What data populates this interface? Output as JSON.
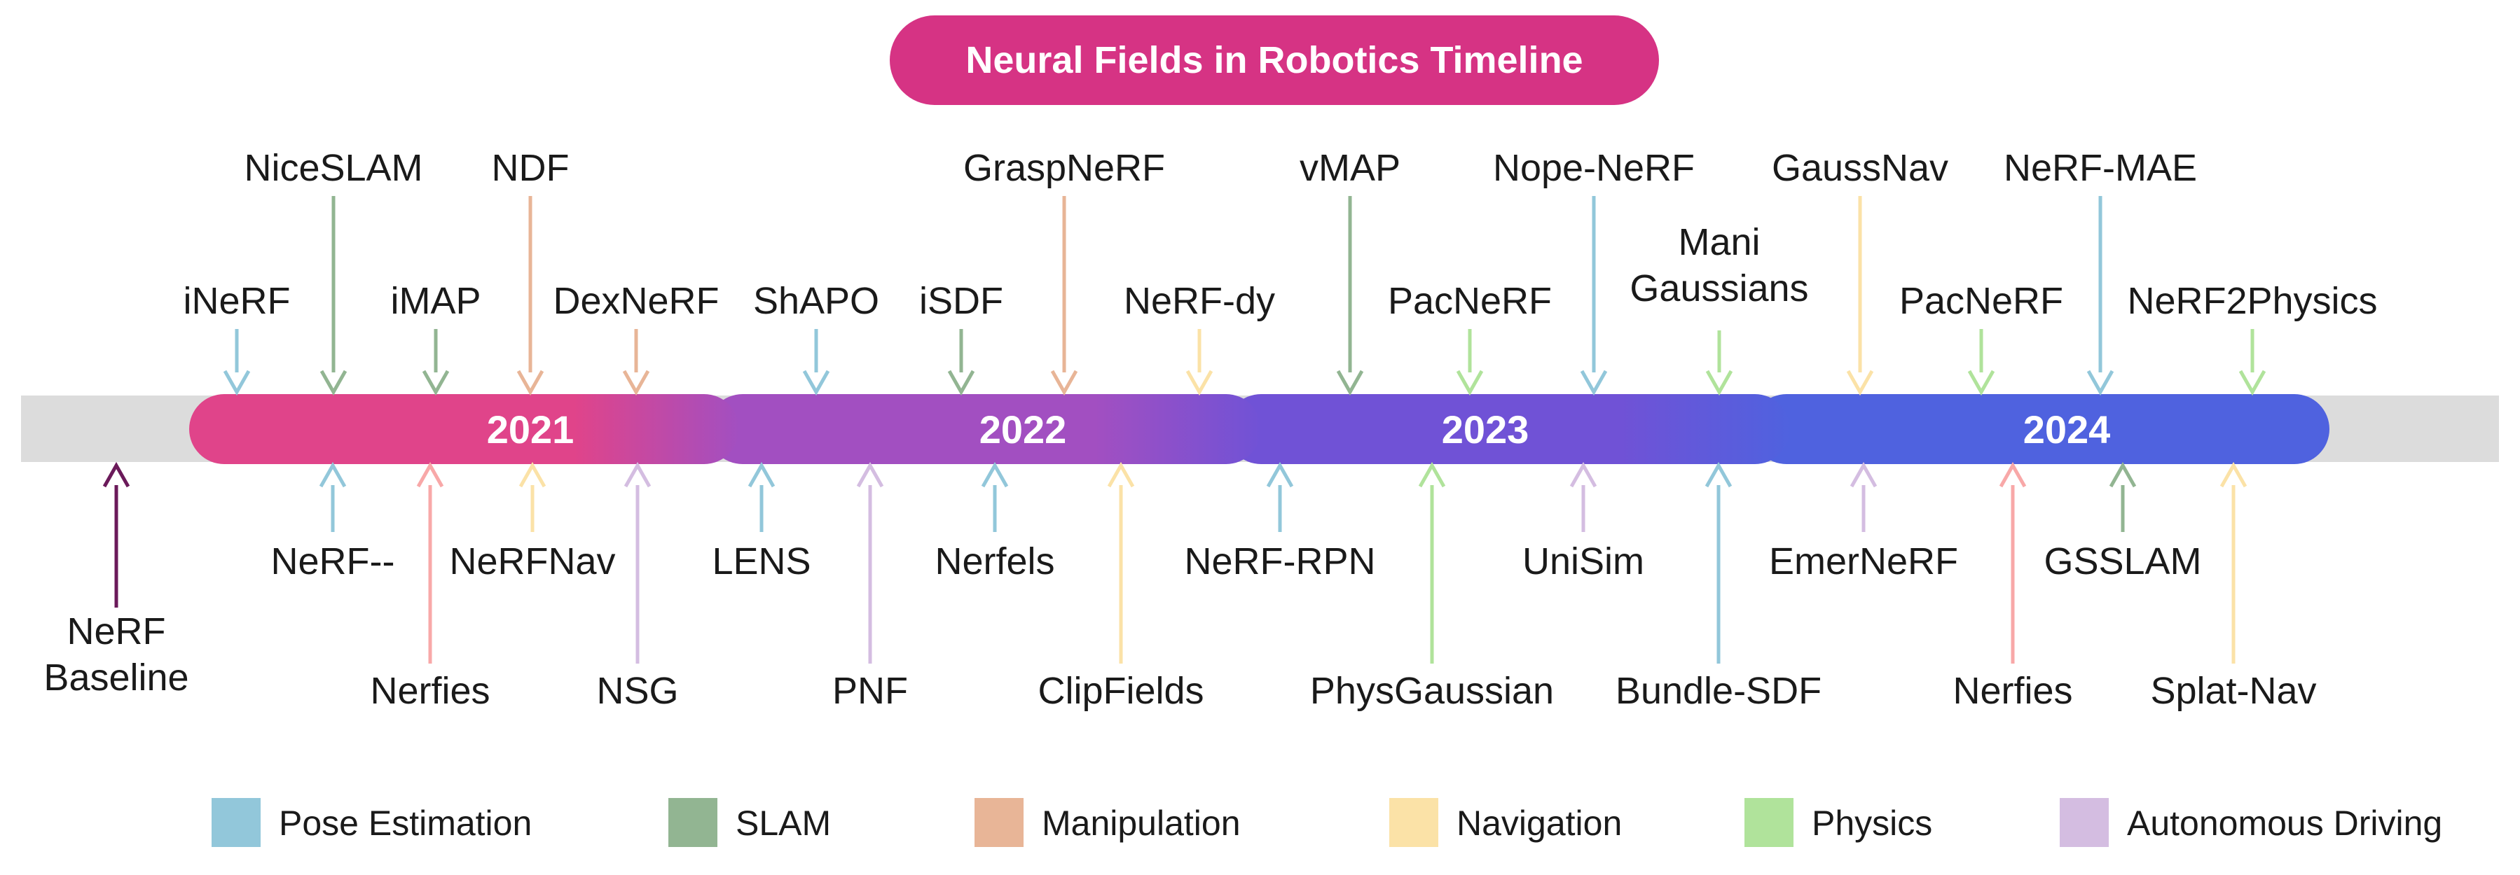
{
  "title": "Neural Fields in Robotics Timeline",
  "colors": {
    "title_bg": "#d63384",
    "track": "#dcdcdc",
    "years": [
      "#e0448a",
      "#a24fc1",
      "#7052d6",
      "#4f62df"
    ],
    "Pose Estimation": "#92c7da",
    "SLAM": "#92b592",
    "Manipulation": "#e8b597",
    "Navigation": "#fbe2a7",
    "Physics": "#b0e39b",
    "Autonomous Driving": "#d4bde1",
    "Pink": "#f8a8a8",
    "Baseline": "#6b1a5a"
  },
  "years": [
    "2021",
    "2022",
    "2023",
    "2024"
  ],
  "top": [
    {
      "label": "iNeRF",
      "cat": "Pose Estimation",
      "row": 0
    },
    {
      "label": "NiceSLAM",
      "cat": "SLAM",
      "row": 2
    },
    {
      "label": "iMAP",
      "cat": "SLAM",
      "row": 0
    },
    {
      "label": "NDF",
      "cat": "Manipulation",
      "row": 2
    },
    {
      "label": "DexNeRF",
      "cat": "Manipulation",
      "row": 0
    },
    {
      "label": "ShAPO",
      "cat": "Pose Estimation",
      "row": 0
    },
    {
      "label": "iSDF",
      "cat": "SLAM",
      "row": 0
    },
    {
      "label": "GraspNeRF",
      "cat": "Manipulation",
      "row": 2
    },
    {
      "label": "NeRF-dy",
      "cat": "Navigation",
      "row": 0
    },
    {
      "label": "vMAP",
      "cat": "SLAM",
      "row": 2
    },
    {
      "label": "PacNeRF",
      "cat": "Physics",
      "row": 0
    },
    {
      "label": "Nope-NeRF",
      "cat": "Pose Estimation",
      "row": 2
    },
    {
      "label": "Mani\nGaussians",
      "cat": "Physics",
      "row": 1
    },
    {
      "label": "GaussNav",
      "cat": "Navigation",
      "row": 2
    },
    {
      "label": "PacNeRF",
      "cat": "Physics",
      "row": 0
    },
    {
      "label": "NeRF-MAE",
      "cat": "Pose Estimation",
      "row": 2
    },
    {
      "label": "NeRF2Physics",
      "cat": "Physics",
      "row": 0
    }
  ],
  "bottom": [
    {
      "label": "NeRF\nBaseline",
      "cat": "Baseline",
      "row": 2
    },
    {
      "label": "NeRF--",
      "cat": "Pose Estimation",
      "row": 0
    },
    {
      "label": "Nerfies",
      "cat": "Pink",
      "row": 1
    },
    {
      "label": "NeRFNav",
      "cat": "Navigation",
      "row": 0
    },
    {
      "label": "NSG",
      "cat": "Autonomous Driving",
      "row": 1
    },
    {
      "label": "LENS",
      "cat": "Pose Estimation",
      "row": 0
    },
    {
      "label": "PNF",
      "cat": "Autonomous Driving",
      "row": 1
    },
    {
      "label": "Nerfels",
      "cat": "Pose Estimation",
      "row": 0
    },
    {
      "label": "ClipFields",
      "cat": "Navigation",
      "row": 1
    },
    {
      "label": "NeRF-RPN",
      "cat": "Pose Estimation",
      "row": 0
    },
    {
      "label": "PhysGaussian",
      "cat": "Physics",
      "row": 1
    },
    {
      "label": "UniSim",
      "cat": "Autonomous Driving",
      "row": 0
    },
    {
      "label": "Bundle-SDF",
      "cat": "Pose Estimation",
      "row": 1
    },
    {
      "label": "EmerNeRF",
      "cat": "Autonomous Driving",
      "row": 0
    },
    {
      "label": "Nerfies",
      "cat": "Pink",
      "row": 1
    },
    {
      "label": "GSSLAM",
      "cat": "SLAM",
      "row": 0
    },
    {
      "label": "Splat-Nav",
      "cat": "Navigation",
      "row": 1
    }
  ],
  "legend": [
    "Pose Estimation",
    "SLAM",
    "Manipulation",
    "Navigation",
    "Physics",
    "Autonomous Driving"
  ]
}
